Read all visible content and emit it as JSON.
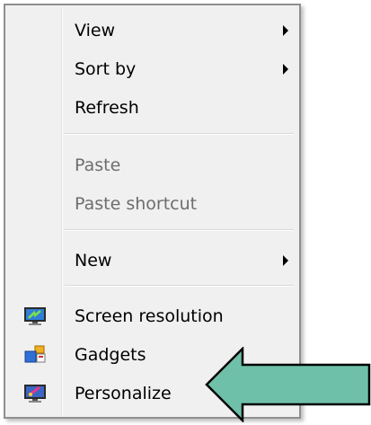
{
  "context_menu": {
    "items": [
      {
        "label": "View",
        "submenu": true,
        "enabled": true
      },
      {
        "label": "Sort by",
        "submenu": true,
        "enabled": true
      },
      {
        "label": "Refresh",
        "submenu": false,
        "enabled": true
      },
      {
        "label": "Paste",
        "submenu": false,
        "enabled": false
      },
      {
        "label": "Paste shortcut",
        "submenu": false,
        "enabled": false
      },
      {
        "label": "New",
        "submenu": true,
        "enabled": true
      },
      {
        "label": "Screen resolution",
        "submenu": false,
        "enabled": true,
        "icon": "monitor-resolution-icon"
      },
      {
        "label": "Gadgets",
        "submenu": false,
        "enabled": true,
        "icon": "gadgets-icon"
      },
      {
        "label": "Personalize",
        "submenu": false,
        "enabled": true,
        "icon": "personalize-icon"
      }
    ]
  },
  "annotation": {
    "icon": "green-pointing-arrow",
    "color": "#6fc0a8",
    "points_to": "Personalize"
  }
}
